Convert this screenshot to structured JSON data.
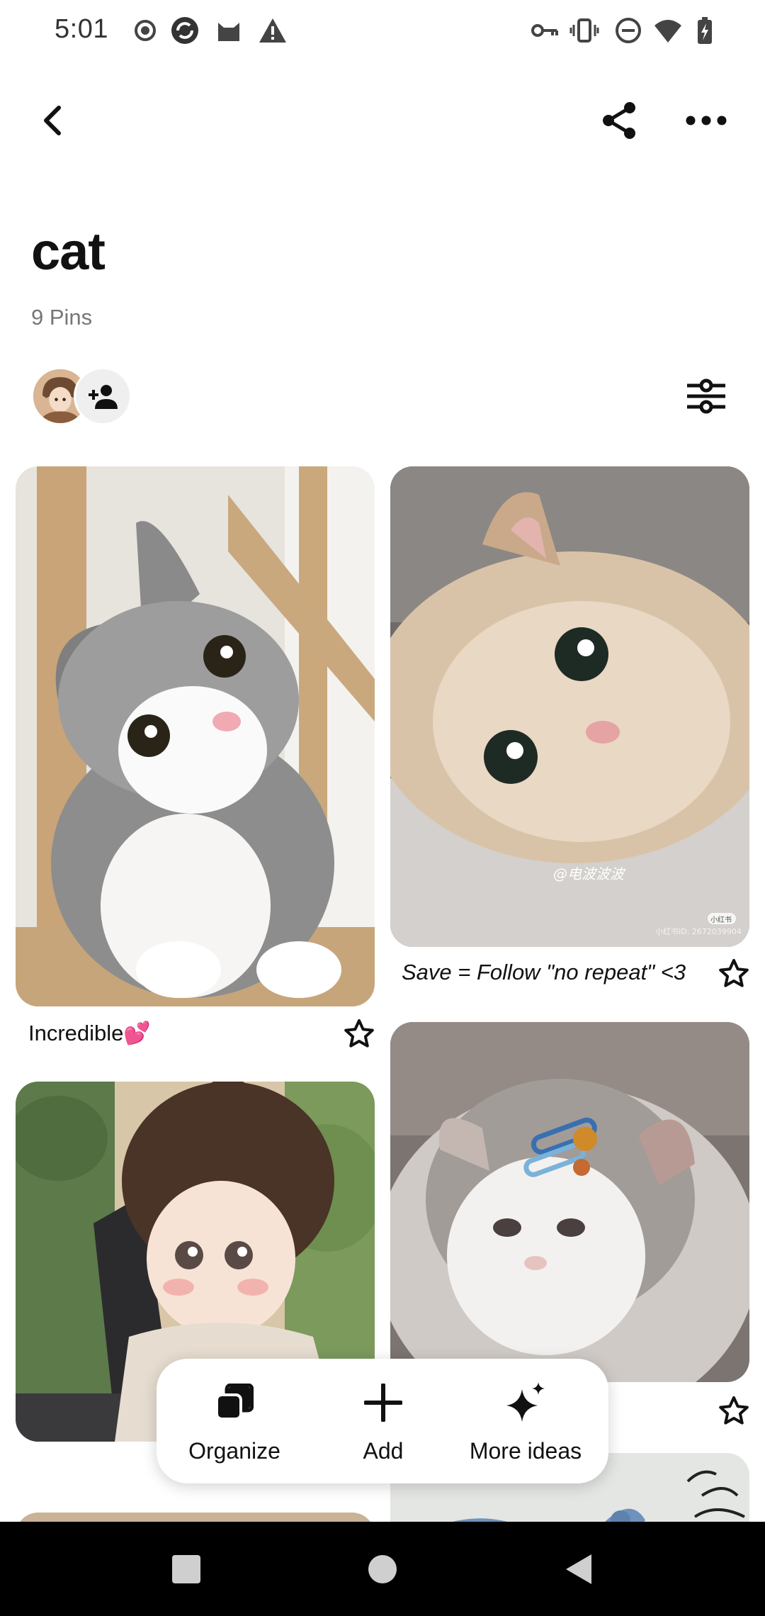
{
  "status_bar": {
    "time": "5:01",
    "left_icons": [
      "record-icon",
      "sync-app-icon",
      "cat-app-icon",
      "warning-icon"
    ],
    "right_icons": [
      "vpn-key-icon",
      "vibrate-icon",
      "do-not-disturb-icon",
      "wifi-icon",
      "battery-charging-icon"
    ]
  },
  "header": {
    "back_icon": "chevron-left-icon",
    "share_icon": "share-icon",
    "more_icon": "more-horizontal-icon"
  },
  "board": {
    "title": "cat",
    "pin_count": "9 Pins",
    "collab_icon": "add-person-icon",
    "filter_icon": "sliders-icon"
  },
  "pins": [
    {
      "caption": "Incredible💕",
      "image": "grey-white-kitten-photo",
      "star_icon": "star-outline-icon"
    },
    {
      "caption": "Save = Follow \"no repeat\" <3",
      "image": "fluffy-cream-kitten-lying-photo",
      "star_icon": "star-outline-icon",
      "watermark": "@电波波波",
      "watermark_small": "小红书ID: 2672039904",
      "badge": "小红书"
    },
    {
      "caption": "",
      "image": "illustrated-girl-at-laptop"
    },
    {
      "caption": "",
      "image": "fluffy-kitten-with-hairclips-photo",
      "star_icon": "star-outline-icon"
    },
    {
      "caption": "",
      "image": "partial-pin-bottom-left"
    },
    {
      "caption": "",
      "image": "bird-sketch-pin"
    }
  ],
  "actions": [
    {
      "label": "Organize",
      "icon": "organize-icon"
    },
    {
      "label": "Add",
      "icon": "plus-icon"
    },
    {
      "label": "More ideas",
      "icon": "sparkle-icon"
    }
  ],
  "nav": {
    "recents_icon": "square-icon",
    "home_icon": "circle-icon",
    "back_icon": "triangle-back-icon"
  },
  "colors": {
    "text": "#111111",
    "muted": "#767676",
    "chip_bg": "#efefef",
    "nav_bg": "#000000"
  }
}
